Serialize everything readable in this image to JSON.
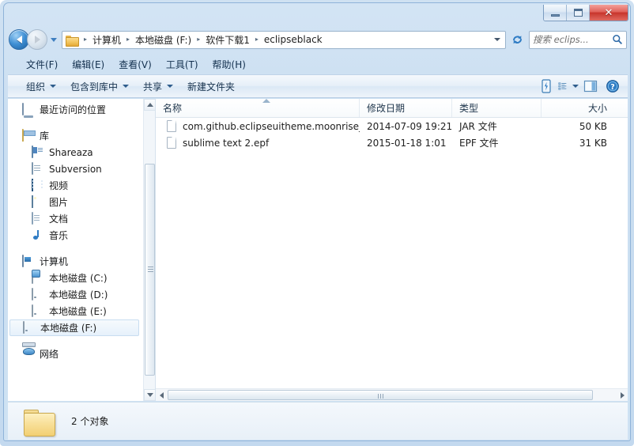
{
  "window": {
    "controls": {
      "minimize": "minimize",
      "maximize": "maximize",
      "close": "✕"
    }
  },
  "address_bar": {
    "back_tooltip": "back",
    "forward_tooltip": "forward",
    "folder_icon": "folder-icon",
    "breadcrumbs": [
      {
        "label": "计算机"
      },
      {
        "label": "本地磁盘 (F:)"
      },
      {
        "label": "软件下载1"
      },
      {
        "label": "eclipseblack"
      }
    ],
    "separator": "▸",
    "refresh_icon": "refresh-icon"
  },
  "search": {
    "placeholder": "搜索 eclips...",
    "icon": "search-icon"
  },
  "menubar": {
    "items": [
      {
        "label": "文件(F)"
      },
      {
        "label": "编辑(E)"
      },
      {
        "label": "查看(V)"
      },
      {
        "label": "工具(T)"
      },
      {
        "label": "帮助(H)"
      }
    ]
  },
  "toolbar": {
    "items": [
      {
        "label": "组织",
        "has_caret": true
      },
      {
        "label": "包含到库中",
        "has_caret": true
      },
      {
        "label": "共享",
        "has_caret": true
      },
      {
        "label": "新建文件夹",
        "has_caret": false
      }
    ],
    "right_icons": [
      {
        "name": "burn-icon"
      },
      {
        "name": "view-list-icon"
      },
      {
        "name": "preview-pane-icon"
      },
      {
        "name": "help-icon"
      }
    ]
  },
  "sidebar": {
    "items": [
      {
        "label": "最近访问的位置",
        "icon": "recent-places-icon",
        "level": 1,
        "selected": false
      },
      {
        "label": "库",
        "icon": "library-icon",
        "level": 1,
        "selected": false
      },
      {
        "label": "Shareaza",
        "icon": "shareaza-icon",
        "level": 2,
        "selected": false
      },
      {
        "label": "Subversion",
        "icon": "subversion-icon",
        "level": 2,
        "selected": false
      },
      {
        "label": "视频",
        "icon": "video-icon",
        "level": 2,
        "selected": false
      },
      {
        "label": "图片",
        "icon": "picture-icon",
        "level": 2,
        "selected": false
      },
      {
        "label": "文档",
        "icon": "document-icon",
        "level": 2,
        "selected": false
      },
      {
        "label": "音乐",
        "icon": "music-icon",
        "level": 2,
        "selected": false
      },
      {
        "label": "计算机",
        "icon": "computer-icon",
        "level": 1,
        "selected": false
      },
      {
        "label": "本地磁盘 (C:)",
        "icon": "system-drive-icon",
        "level": 2,
        "selected": false
      },
      {
        "label": "本地磁盘 (D:)",
        "icon": "drive-icon",
        "level": 2,
        "selected": false
      },
      {
        "label": "本地磁盘 (E:)",
        "icon": "drive-icon",
        "level": 2,
        "selected": false
      },
      {
        "label": "本地磁盘 (F:)",
        "icon": "drive-icon",
        "level": 2,
        "selected": true
      },
      {
        "label": "网络",
        "icon": "network-icon",
        "level": 1,
        "selected": false
      }
    ]
  },
  "file_list": {
    "columns": [
      {
        "key": "name",
        "label": "名称",
        "sorted": true,
        "sort_direction": "asc"
      },
      {
        "key": "date",
        "label": "修改日期",
        "sorted": false
      },
      {
        "key": "type",
        "label": "类型",
        "sorted": false
      },
      {
        "key": "size",
        "label": "大小",
        "sorted": false
      }
    ],
    "rows": [
      {
        "icon": "file-icon",
        "name": "com.github.eclipseuitheme.moonrise_...",
        "date": "2014-07-09 19:21",
        "type": "JAR 文件",
        "size": "50 KB"
      },
      {
        "icon": "file-icon",
        "name": "sublime text 2.epf",
        "date": "2015-01-18 1:01",
        "type": "EPF 文件",
        "size": "31 KB"
      }
    ]
  },
  "status_bar": {
    "icon": "folder-icon",
    "text": "2 个对象"
  },
  "colors": {
    "frame": "#cfe1f2",
    "accent": "#3f8fd4",
    "close_button": "#c8352c",
    "selection": "#e6f1fb",
    "text": "#1b1b1b"
  }
}
